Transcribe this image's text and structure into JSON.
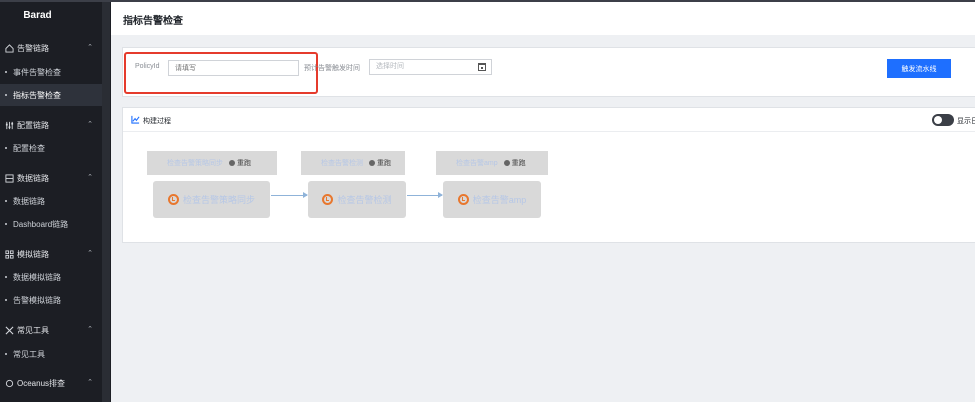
{
  "sidebar": {
    "brand": "Barad",
    "groups": [
      {
        "label": "告警链路",
        "icon": "home-icon",
        "items": [
          {
            "label": "事件告警检查"
          },
          {
            "label": "指标告警检查",
            "active": true
          }
        ]
      },
      {
        "label": "配置链路",
        "icon": "sliders-icon",
        "items": [
          {
            "label": "配置检查"
          }
        ]
      },
      {
        "label": "数据链路",
        "icon": "database-icon",
        "items": [
          {
            "label": "数据链路"
          },
          {
            "label": "Dashboard链路"
          }
        ]
      },
      {
        "label": "模拟链路",
        "icon": "grid-icon",
        "items": [
          {
            "label": "数据模拟链路"
          },
          {
            "label": "告警模拟链路"
          }
        ]
      },
      {
        "label": "常见工具",
        "icon": "tools-icon",
        "items": [
          {
            "label": "常见工具"
          }
        ]
      },
      {
        "label": "Oceanus排查",
        "icon": "ocean-icon",
        "items": []
      }
    ]
  },
  "header": {
    "title": "指标告警检查"
  },
  "filter": {
    "policy_label": "PolicyId",
    "policy_placeholder": "请填写",
    "time_label": "预计告警触发时间",
    "time_placeholder": "选择时间",
    "trigger_button": "触发流水线"
  },
  "process": {
    "title": "构建过程",
    "toggle_label": "显示日",
    "steps": [
      {
        "top_name": "检查告警策略同步",
        "retry": "重跑",
        "name": "检查告警策略同步"
      },
      {
        "top_name": "检查告警检测",
        "retry": "重跑",
        "name": "检查告警检测"
      },
      {
        "top_name": "检查告警amp",
        "retry": "重跑",
        "name": "检查告警amp"
      }
    ]
  },
  "colors": {
    "accent": "#1e6fff",
    "highlight": "#e53b2c",
    "sidebar_bg": "#1c1e24",
    "step_icon": "#e8772e"
  }
}
